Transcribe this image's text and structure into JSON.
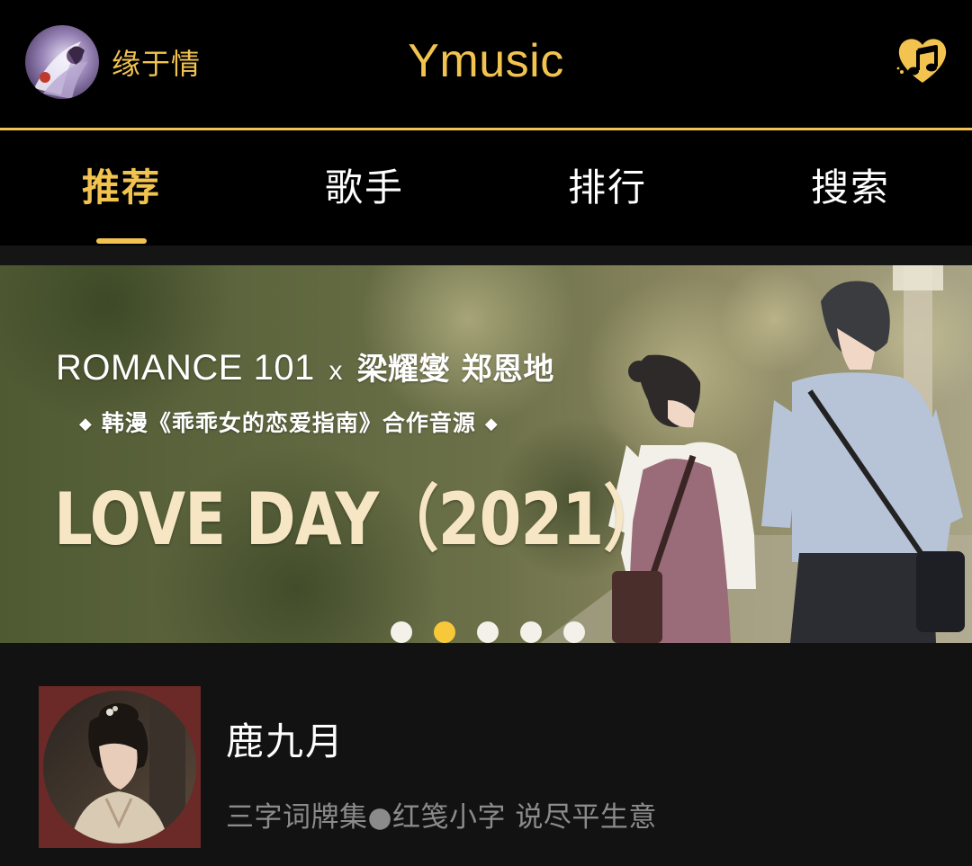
{
  "header": {
    "username": "缘于情",
    "app_title": "Ymusic",
    "avatar_icon": "user-avatar",
    "music_icon": "music-note-heart-icon"
  },
  "tabs": [
    {
      "label": "推荐",
      "active": true
    },
    {
      "label": "歌手",
      "active": false
    },
    {
      "label": "排行",
      "active": false
    },
    {
      "label": "搜索",
      "active": false
    }
  ],
  "banner": {
    "line1_en": "ROMANCE 101",
    "line1_x": "x",
    "line1_cn": "梁耀燮 郑恩地",
    "line2": "韩漫《乖乖女的恋爱指南》合作音源",
    "line2_bullet": "◆",
    "line3": "LOVE DAY（2021）",
    "slide_count": 5,
    "active_slide": 2
  },
  "list": {
    "items": [
      {
        "title": "鹿九月",
        "description": "三字词牌集●红笺小字 说尽平生意"
      }
    ]
  },
  "colors": {
    "accent": "#f2c34f",
    "background": "#000000",
    "list_background": "#121212",
    "muted_text": "#8b8b8b",
    "cover_frame": "#6b2a27"
  }
}
